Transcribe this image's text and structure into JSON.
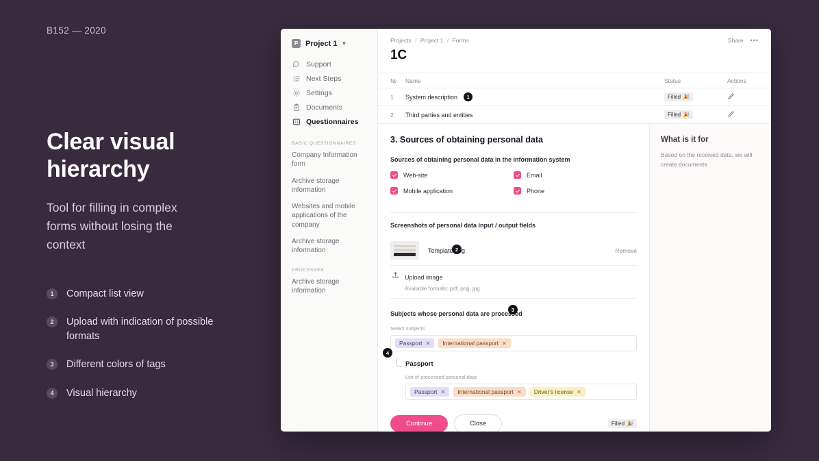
{
  "slide": {
    "case_id": "B152 — 2020",
    "headline": "Clear visual hierarchy",
    "subhead": "Tool for filling in complex forms without losing the context",
    "features": [
      {
        "num": "1",
        "text": "Compact list view"
      },
      {
        "num": "2",
        "text": "Upload with indication of possible formats"
      },
      {
        "num": "3",
        "text": "Different colors of tags"
      },
      {
        "num": "4",
        "text": "Visual hierarchy"
      }
    ],
    "accent_color": "#ef4d8a",
    "background_color": "#372b3d"
  },
  "sidebar": {
    "project": {
      "badge": "P",
      "name": "Project 1",
      "chevron": "chevron-down-icon"
    },
    "nav": [
      {
        "label": "Support",
        "icon": "chat-bubble-icon",
        "active": false
      },
      {
        "label": "Next Steps",
        "icon": "list-icon",
        "active": false
      },
      {
        "label": "Settings",
        "icon": "gear-icon",
        "active": false
      },
      {
        "label": "Documents",
        "icon": "clipboard-icon",
        "active": false
      },
      {
        "label": "Questionnaires",
        "icon": "questionnaire-icon",
        "active": true
      }
    ],
    "groups": [
      {
        "title": "BASIC QUESTIONNAIRES",
        "items": [
          "Company Information form",
          "Archive storage information",
          "Websites and mobile applications of the company",
          "Archive storage information"
        ]
      },
      {
        "title": "PROCESSES",
        "items": [
          "Archive storage information"
        ]
      }
    ]
  },
  "header": {
    "breadcrumb": [
      "Projects",
      "Project 1",
      "Forms"
    ],
    "separator": "/",
    "title": "1C",
    "share_label": "Share",
    "more_label": "•••"
  },
  "table": {
    "columns": [
      "№",
      "Name",
      "Status",
      "Actions"
    ],
    "rows": [
      {
        "num": "1",
        "name": "System description",
        "status": "Filled",
        "status_emoji": "🎉",
        "action_icon": "pencil-icon",
        "callout": "1"
      },
      {
        "num": "2",
        "name": "Third parties and entities",
        "status": "Filled",
        "status_emoji": "🎉",
        "action_icon": "pencil-icon",
        "callout": ""
      }
    ]
  },
  "form": {
    "section_title": "3. Sources of obtaining personal data",
    "sources_label": "Sources of obtaining personal data in the information system",
    "sources": [
      {
        "label": "Web-site",
        "checked": true
      },
      {
        "label": "Email",
        "checked": true
      },
      {
        "label": "Mobile application",
        "checked": true
      },
      {
        "label": "Phone",
        "checked": true
      }
    ],
    "screenshots_label": "Screenshots of personal data input / output fields",
    "file": {
      "name": "Template.png",
      "remove_label": "Remove",
      "thumb_icon": "document-thumbnail"
    },
    "upload": {
      "icon": "upload-icon",
      "label": "Upload image",
      "hint": "Available formats: pdf, png, jpg",
      "callout": "2"
    },
    "subjects_label": "Subjects whose personal data are processed",
    "select_subjects_label": "Select subjects",
    "selected_subjects": [
      {
        "label": "Passport",
        "color": "purple",
        "close": "✕"
      },
      {
        "label": "International passport",
        "color": "orange",
        "close": "✕"
      }
    ],
    "subjects_callout": "3",
    "nested": {
      "title": "Passport",
      "list_label": "List of processed personal data",
      "callout": "4",
      "tags": [
        {
          "label": "Passport",
          "color": "purple",
          "close": "✕"
        },
        {
          "label": "International passport",
          "color": "orange",
          "close": "✕"
        },
        {
          "label": "Driver's license",
          "color": "yellow",
          "close": "✕"
        }
      ]
    },
    "buttons": {
      "primary": "Continue",
      "secondary": "Close",
      "status_badge": "Filled",
      "status_emoji": "🎉"
    }
  },
  "aside": {
    "title": "What is it for",
    "text": "Based on the received data, we will create documents"
  }
}
